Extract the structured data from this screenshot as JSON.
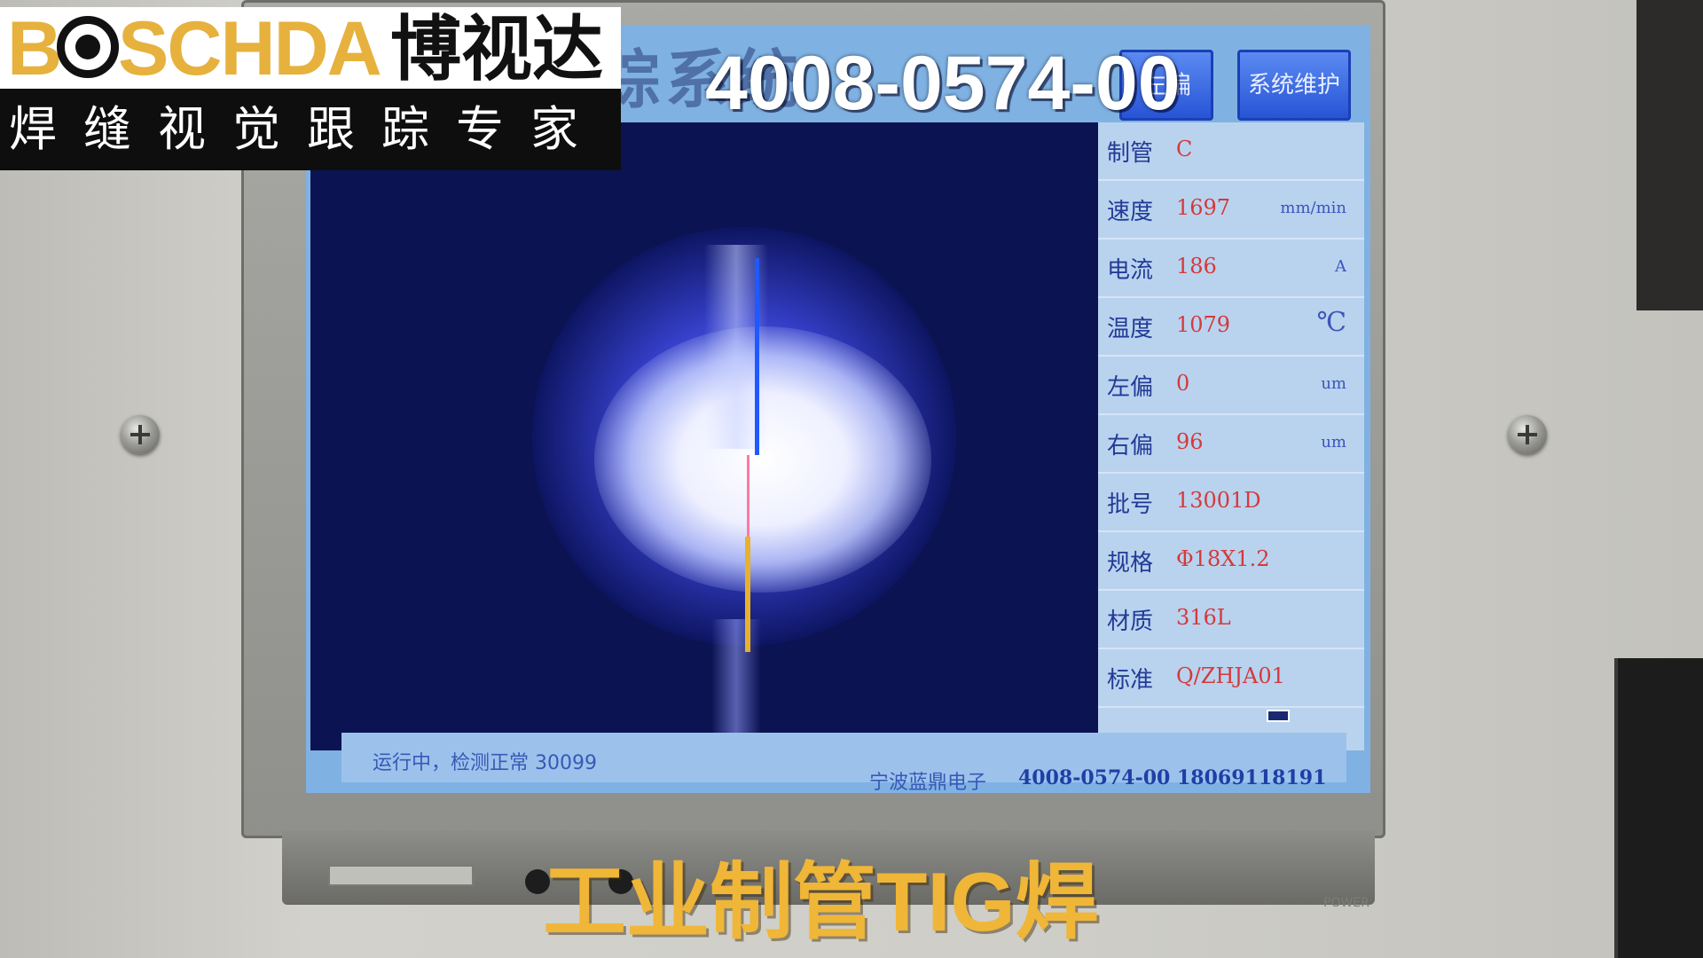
{
  "logo": {
    "brand": "BOSCHDA",
    "brand_cn": "博视达",
    "tagline": "焊缝视觉跟踪专家"
  },
  "overlay": {
    "phone": "4008-0574-00",
    "caption": "工业制管TIG焊"
  },
  "screen": {
    "title": "觉焊接跟踪系统",
    "buttons": {
      "left": "左偏",
      "maintain": "系统维护"
    }
  },
  "params": [
    {
      "label": "制管",
      "value": "C",
      "unit": ""
    },
    {
      "label": "速度",
      "value": "1697",
      "unit": "mm/min"
    },
    {
      "label": "电流",
      "value": "186",
      "unit": "A"
    },
    {
      "label": "温度",
      "value": "1079",
      "unit": "℃"
    },
    {
      "label": "左偏",
      "value": "0",
      "unit": "um"
    },
    {
      "label": "右偏",
      "value": "96",
      "unit": "um"
    },
    {
      "label": "批号",
      "value": "13001D",
      "unit": ""
    },
    {
      "label": "规格",
      "value": "Φ18X1.2",
      "unit": ""
    },
    {
      "label": "材质",
      "value": "316L",
      "unit": ""
    },
    {
      "label": "标准",
      "value": "Q/ZHJA01",
      "unit": ""
    }
  ],
  "status": {
    "left": "运行中，检测正常 30099",
    "company": "宁波蓝鼎电子",
    "contact": "4008-0574-00 18069118191"
  },
  "monitor": {
    "power_label": "POWER"
  },
  "colors": {
    "screen_bg": "#7fb2e3",
    "param_value": "#d43a3a",
    "param_label": "#233a96",
    "caption": "#f0b637",
    "brand": "#e6b13d"
  }
}
